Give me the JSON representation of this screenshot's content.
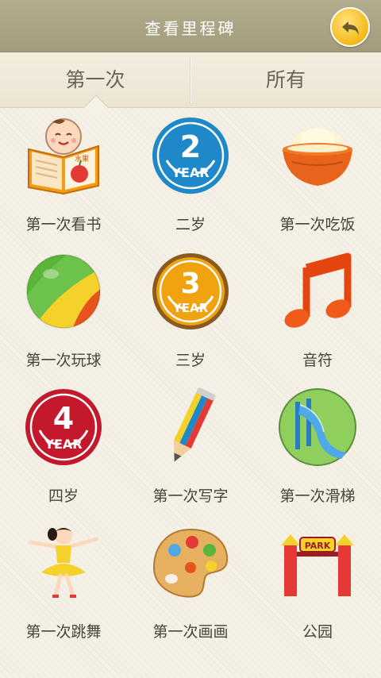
{
  "header": {
    "title": "查看里程碑",
    "back_icon": "back-arrow-icon"
  },
  "tabs": [
    {
      "label": "第一次",
      "selected": true
    },
    {
      "label": "所有",
      "selected": false
    }
  ],
  "milestones": [
    {
      "label": "第一次看书",
      "icon": "reading-baby-icon"
    },
    {
      "label": "二岁",
      "icon": "two-year-badge-icon",
      "badge_number": "2",
      "badge_text": "YEAR"
    },
    {
      "label": "第一次吃饭",
      "icon": "rice-bowl-icon"
    },
    {
      "label": "第一次玩球",
      "icon": "ball-icon"
    },
    {
      "label": "三岁",
      "icon": "three-year-badge-icon",
      "badge_number": "3",
      "badge_text": "YEAR"
    },
    {
      "label": "音符",
      "icon": "music-note-icon"
    },
    {
      "label": "四岁",
      "icon": "four-year-badge-icon",
      "badge_number": "4",
      "badge_text": "YEAR"
    },
    {
      "label": "第一次写字",
      "icon": "pencil-icon"
    },
    {
      "label": "第一次滑梯",
      "icon": "slide-icon"
    },
    {
      "label": "第一次跳舞",
      "icon": "dancer-icon"
    },
    {
      "label": "第一次画画",
      "icon": "palette-icon"
    },
    {
      "label": "公园",
      "icon": "park-gate-icon",
      "sign_text": "PARK"
    }
  ],
  "book_text": "水果",
  "colors": {
    "header": "#a9a384",
    "background": "#f6f1e6",
    "accent": "#f5b91c"
  }
}
